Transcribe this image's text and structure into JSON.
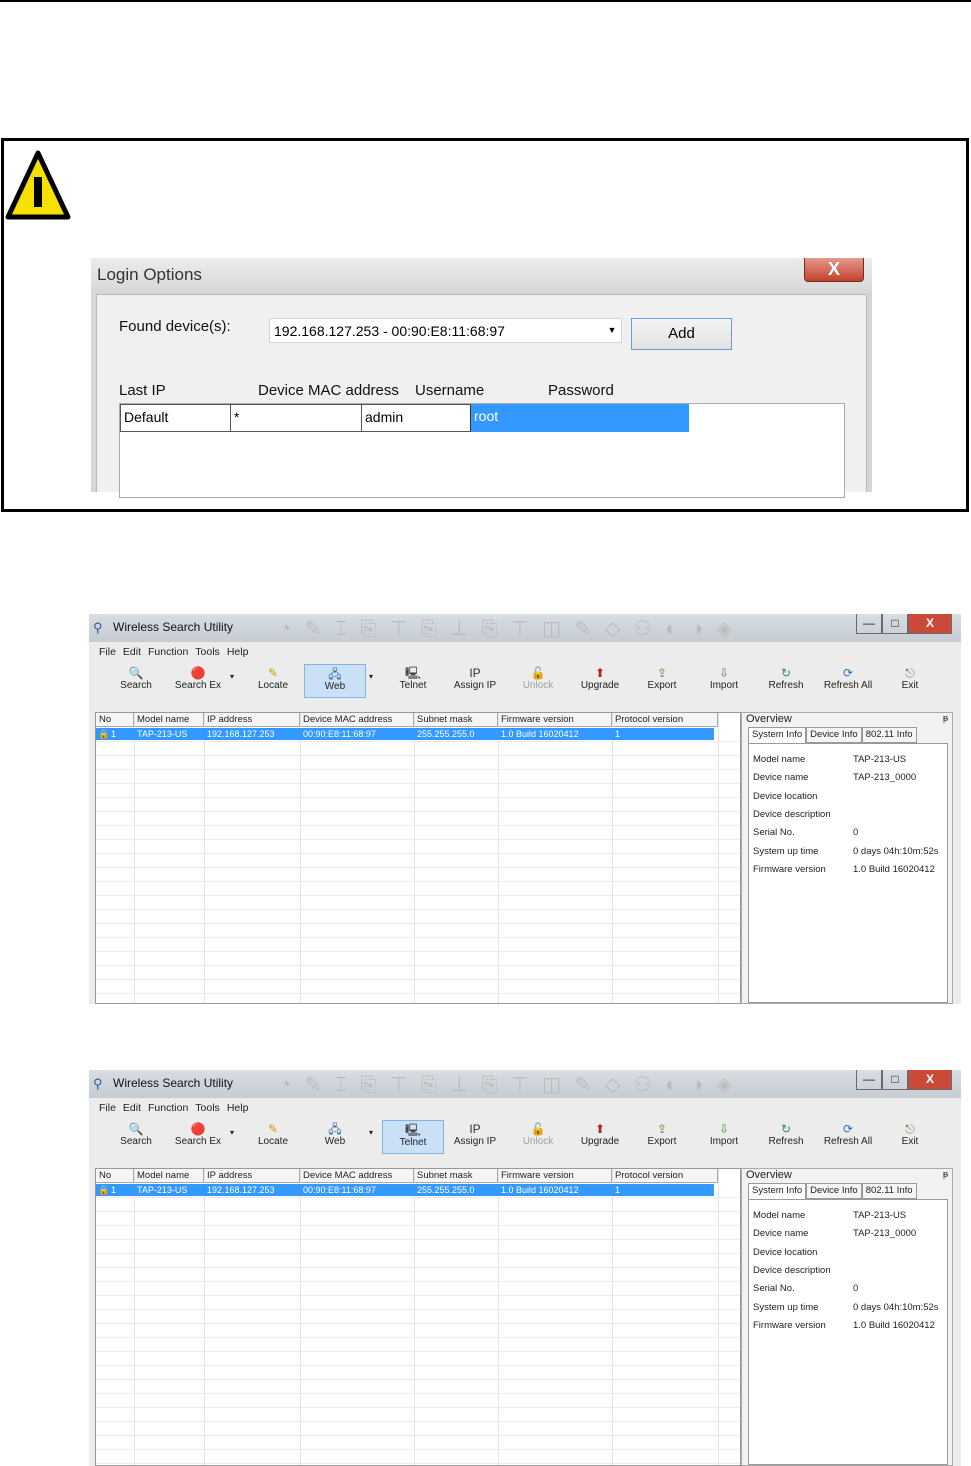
{
  "login_dialog": {
    "title": "Login Options",
    "close": "X",
    "found_label": "Found device(s):",
    "found_value": "192.168.127.253 - 00:90:E8:11:68:97",
    "add_label": "Add",
    "columns": [
      "Last IP",
      "Device MAC address",
      "Username",
      "Password"
    ],
    "row": {
      "last_ip": "Default",
      "mac": "*",
      "username": "admin",
      "password": "root"
    }
  },
  "utility": {
    "title": "Wireless Search Utility",
    "menu": [
      "File",
      "Edit",
      "Function",
      "Tools",
      "Help"
    ],
    "toolbar": [
      "Search",
      "Search Ex",
      "Locate",
      "Web",
      "Telnet",
      "Assign IP",
      "Unlock",
      "Upgrade",
      "Export",
      "Import",
      "Refresh",
      "Refresh All",
      "Exit"
    ],
    "columns": [
      "No",
      "Model name",
      "IP address",
      "Device MAC address",
      "Subnet mask",
      "Firmware version",
      "Protocol version"
    ],
    "row": [
      "1",
      "TAP-213-US",
      "192.168.127.253",
      "00:90:E8:11:68:97",
      "255.255.255.0",
      "1.0 Build 16020412",
      "1"
    ],
    "overview": {
      "title": "Overview",
      "tabs": [
        "System Info",
        "Device Info",
        "802.11 Info"
      ],
      "fields": [
        {
          "k": "Model name",
          "v": "TAP-213-US"
        },
        {
          "k": "Device name",
          "v": "TAP-213_0000"
        },
        {
          "k": "Device location",
          "v": ""
        },
        {
          "k": "Device description",
          "v": ""
        },
        {
          "k": "Serial No.",
          "v": "0"
        },
        {
          "k": "System up time",
          "v": "0 days 04h:10m:52s"
        },
        {
          "k": "Firmware version",
          "v": "1.0 Build 16020412"
        }
      ]
    }
  },
  "window_controls": {
    "minimize": "—",
    "maximize": "□",
    "close": "X"
  },
  "selected_tool": {
    "first": "Web",
    "second": "Telnet"
  },
  "colors": {
    "selection": "#3399ff",
    "warning": "#f5e000"
  }
}
